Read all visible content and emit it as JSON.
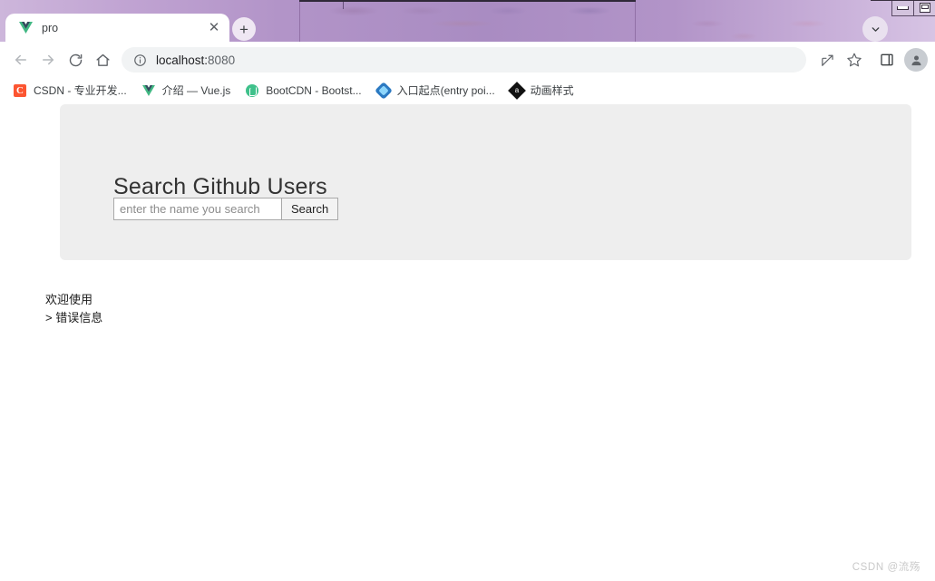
{
  "window": {
    "controls": [
      {
        "name": "minimize",
        "icon": "minimize-icon"
      },
      {
        "name": "maximize",
        "icon": "maximize-icon"
      }
    ]
  },
  "tabstrip": {
    "tab": {
      "title": "pro",
      "favicon": "vue-logo-icon",
      "close_label": "✕"
    },
    "new_tab_label": "+",
    "tab_search_icon": "chevron-down-icon"
  },
  "toolbar": {
    "back_icon": "back-arrow-icon",
    "forward_icon": "forward-arrow-icon",
    "reload_icon": "reload-icon",
    "home_icon": "home-icon",
    "info_icon": "info-circle-icon",
    "url_text": "localhost:",
    "url_port": "8080",
    "share_icon": "share-icon",
    "bookmark_icon": "star-icon",
    "side_panel_icon": "side-panel-icon",
    "profile_icon": "profile-avatar-icon"
  },
  "bookmarks": [
    {
      "label": "CSDN - 专业开发...",
      "icon": "csdn-icon",
      "icon_text": "C"
    },
    {
      "label": "介绍 — Vue.js",
      "icon": "vue-logo-icon"
    },
    {
      "label": "BootCDN - Bootst...",
      "icon": "bootcdn-icon"
    },
    {
      "label": "入口起点(entry poi...",
      "icon": "webpack-icon"
    },
    {
      "label": "动画样式",
      "icon": "animation-icon"
    }
  ],
  "page": {
    "heading": "Search Github Users",
    "search": {
      "placeholder": "enter the name you search",
      "value": "",
      "button_label": "Search"
    },
    "status": {
      "welcome": "欢迎使用",
      "error": "> 错误信息"
    },
    "watermark": "CSDN @流殇"
  },
  "colors": {
    "frame_purple": "#a98cc2",
    "jumbotron_bg": "#eeeeee",
    "vue_green": "#41b883",
    "vue_dark": "#35495e",
    "csdn_red": "#fc5531"
  }
}
